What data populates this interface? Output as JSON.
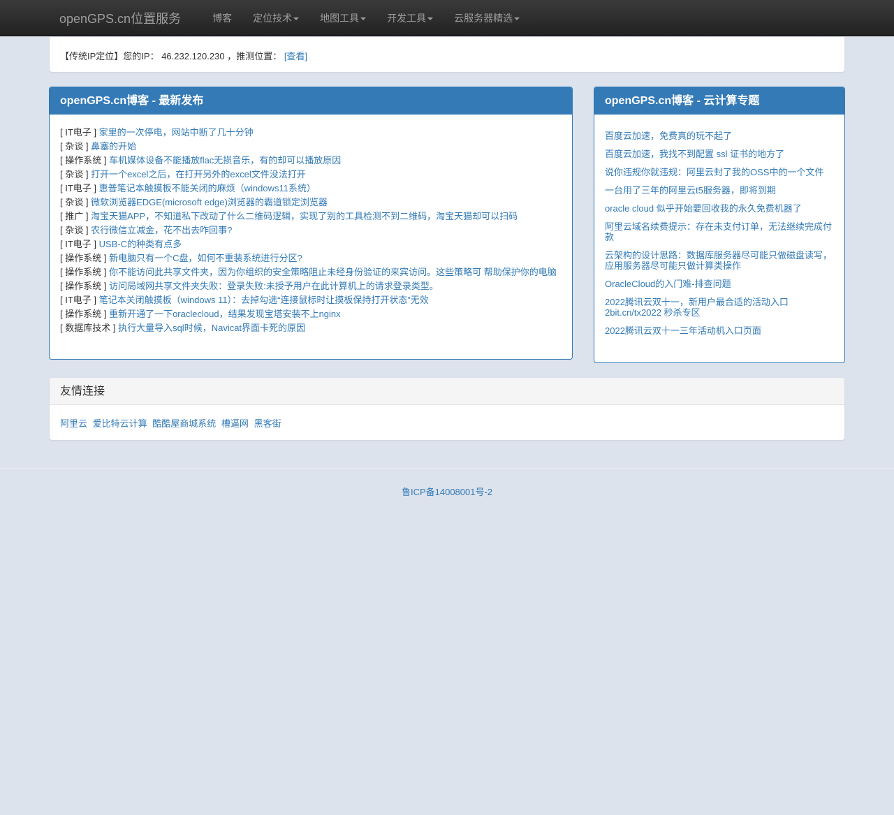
{
  "nav": {
    "brand": "openGPS.cn位置服务",
    "items": [
      {
        "label": "博客",
        "dropdown": false
      },
      {
        "label": "定位技术",
        "dropdown": true
      },
      {
        "label": "地图工具",
        "dropdown": true
      },
      {
        "label": "开发工具",
        "dropdown": true
      },
      {
        "label": "云服务器精选",
        "dropdown": true
      }
    ]
  },
  "ip": {
    "prefix": "【传统IP定位】您的IP：",
    "address": "46.232.120.230",
    "middle": "，推测位置：",
    "link": "[查看]"
  },
  "latest": {
    "title": "openGPS.cn博客 - 最新发布",
    "posts": [
      {
        "cat": "[ IT电子 ]",
        "title": "家里的一次停电，网站中断了几十分钟"
      },
      {
        "cat": "[ 杂谈 ]",
        "title": "鼻塞的开始"
      },
      {
        "cat": "[ 操作系统 ]",
        "title": "车机媒体设备不能播放flac无损音乐，有的却可以播放原因"
      },
      {
        "cat": "[ 杂谈 ]",
        "title": "打开一个excel之后，在打开另外的excel文件没法打开"
      },
      {
        "cat": "[ IT电子 ]",
        "title": "惠普笔记本触摸板不能关闭的麻烦（windows11系统）"
      },
      {
        "cat": "[ 杂谈 ]",
        "title": "微软浏览器EDGE(microsoft edge)浏览器的霸道锁定浏览器"
      },
      {
        "cat": "[ 推广 ]",
        "title": "淘宝天猫APP，不知道私下改动了什么二维码逻辑，实现了别的工具检测不到二维码，淘宝天猫却可以扫码"
      },
      {
        "cat": "[ 杂谈 ]",
        "title": "农行微信立减金，花不出去咋回事?"
      },
      {
        "cat": "[ IT电子 ]",
        "title": "USB-C的种类有点多"
      },
      {
        "cat": "[ 操作系统 ]",
        "title": "新电脑只有一个C盘，如何不重装系统进行分区?"
      },
      {
        "cat": "[ 操作系统 ]",
        "title": "你不能访问此共享文件夹，因为你组织的安全策略阻止未经身份验证的来宾访问。这些策略可 帮助保护你的电脑"
      },
      {
        "cat": "[ 操作系统 ]",
        "title": "访问局域网共享文件夹失败：登录失败:未授予用户在此计算机上的请求登录类型。"
      },
      {
        "cat": "[ IT电子 ]",
        "title": "笔记本关闭触摸板（windows 11）：去掉勾选“连接鼠标时让摸板保持打开状态”无效"
      },
      {
        "cat": "[ 操作系统 ]",
        "title": "重新开通了一下oraclecloud，结果发现宝塔安装不上nginx"
      },
      {
        "cat": "[ 数据库技术 ]",
        "title": "执行大量导入sql时候，Navicat界面卡死的原因"
      }
    ]
  },
  "cloud": {
    "title": "openGPS.cn博客 - 云计算专题",
    "posts": [
      "百度云加速，免费真的玩不起了",
      "百度云加速，我找不到配置 ssl 证书的地方了",
      "说你违规你就违规：阿里云封了我的OSS中的一个文件",
      "一台用了三年的阿里云t5服务器，即将到期",
      "oracle cloud 似乎开始要回收我的永久免费机器了",
      "阿里云域名续费提示：存在未支付订单，无法继续完成付款",
      "云架构的设计思路：数据库服务器尽可能只做磁盘读写，应用服务器尽可能只做计算类操作",
      "OracleCloud的入门难-排查问题",
      "2022腾讯云双十一，新用户最合适的活动入口 2bit.cn/tx2022 秒杀专区",
      "2022腾讯云双十一三年活动机入口页面"
    ]
  },
  "links": {
    "title": "友情连接",
    "items": [
      "阿里云",
      "爱比特云计算",
      "酷酷屋商城系统",
      "槽逼网",
      "黑客街"
    ]
  },
  "footer": {
    "icp": "鲁ICP备14008001号-2"
  },
  "colors": {
    "link": "#337ab7",
    "panel_primary": "#337ab7",
    "navbar": "#222222",
    "background": "#dde3ec"
  }
}
